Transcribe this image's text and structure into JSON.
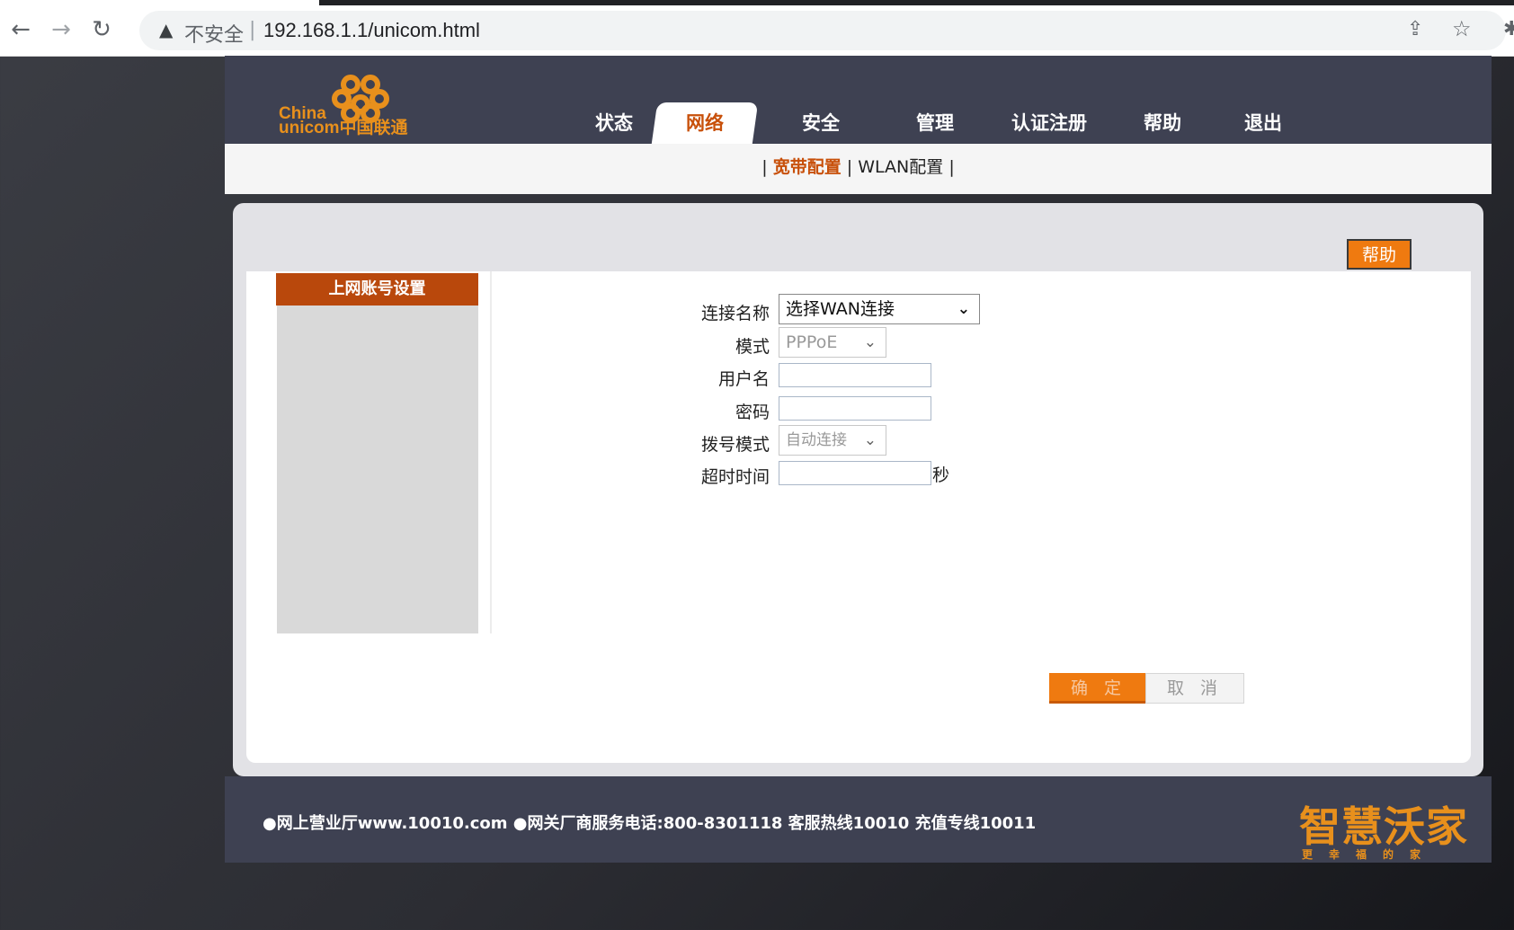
{
  "browser": {
    "back_icon": "arrow-left-icon",
    "forward_icon": "arrow-right-icon",
    "reload_icon": "reload-icon",
    "security_label": "不安全",
    "separator": "|",
    "url": "192.168.1.1/unicom.html"
  },
  "logo": {
    "line1": "China",
    "line2": "unicom中国联通"
  },
  "nav": {
    "items": [
      {
        "label": "状态"
      },
      {
        "label": "网络"
      },
      {
        "label": "安全"
      },
      {
        "label": "管理"
      },
      {
        "label": "认证注册"
      },
      {
        "label": "帮助"
      },
      {
        "label": "退出"
      }
    ],
    "active": "网络"
  },
  "subnav": {
    "bar": "|",
    "items": [
      {
        "label": "宽带配置"
      },
      {
        "label": "WLAN配置"
      }
    ],
    "active": "宽带配置"
  },
  "help_button": "帮助",
  "sidebar": {
    "title": "上网账号设置"
  },
  "form": {
    "connection_name": {
      "label": "连接名称",
      "value": "选择WAN连接"
    },
    "mode": {
      "label": "模式",
      "value": "PPPoE"
    },
    "username": {
      "label": "用户名",
      "value": ""
    },
    "password": {
      "label": "密码",
      "value": ""
    },
    "dial_mode": {
      "label": "拨号模式",
      "value": "自动连接"
    },
    "timeout": {
      "label": "超时时间",
      "value": "",
      "unit": "秒"
    }
  },
  "buttons": {
    "confirm": "确 定",
    "cancel": "取 消"
  },
  "footer": {
    "text": "●网上营业厅www.10010.com ●网关厂商服务电话:800-8301118 客服热线10010 充值专线10011",
    "brand": "智慧沃家",
    "brand_sub": "更幸福的家"
  },
  "colors": {
    "header_bg": "#3e4152",
    "accent": "#ef7a10",
    "active_text": "#c8500a",
    "sidebar_title": "#b9480c"
  }
}
